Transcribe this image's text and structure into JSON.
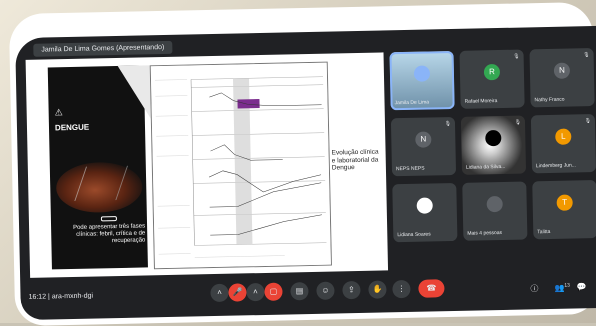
{
  "presenter_label": "Jamila De Lima Gomes (Apresentando)",
  "slide": {
    "left_title": "DENGUE",
    "description": "Pode apresentar três fases clínicas: febril, crítica e de recuperação",
    "right_text": "Evolução clínica e laboratorial da Dengue"
  },
  "participants": [
    {
      "name": "Jamila De Lima",
      "initial": "",
      "color": "#8ab4f8",
      "muted": false
    },
    {
      "name": "Rafael Moreira",
      "initial": "R",
      "color": "#33a852",
      "muted": true
    },
    {
      "name": "Nathy Franco",
      "initial": "N",
      "color": "#5f6368",
      "muted": true
    },
    {
      "name": "NEPS NEPS",
      "initial": "N",
      "color": "#5f6368",
      "muted": true
    },
    {
      "name": "Lidiana da Silva...",
      "initial": "",
      "color": "#000000",
      "muted": true
    },
    {
      "name": "Lindemberg Jun...",
      "initial": "L",
      "color": "#f29900",
      "muted": true
    },
    {
      "name": "Lidiana Soares",
      "initial": "",
      "color": "#ffffff",
      "muted": false
    },
    {
      "name": "Mais 4 pessoas",
      "initial": "",
      "color": "#5f6368",
      "muted": false
    },
    {
      "name": "Talitta",
      "initial": "T",
      "color": "#f29900",
      "muted": false
    }
  ],
  "bottom": {
    "time": "16:12",
    "separator": "|",
    "meeting_code": "ara-mxnh-dgi",
    "people_count": "13"
  }
}
